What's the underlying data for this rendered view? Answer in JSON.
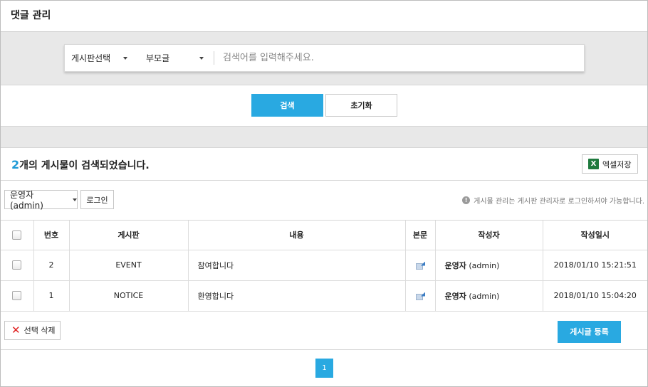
{
  "page": {
    "title": "댓글 관리"
  },
  "search": {
    "board_select": "게시판선택",
    "category_select": "부모글",
    "placeholder": "검색어를 입력해주세요.",
    "search_button": "검색",
    "reset_button": "초기화"
  },
  "results": {
    "count": "2",
    "text": "개의 게시물이 검색되었습니다.",
    "excel_button": "엑셀저장"
  },
  "admin": {
    "selected": "운영자 (admin)",
    "login_button": "로그인",
    "notice": "게시물 관리는 게시판 관리자로 로그인하셔야 가능합니다."
  },
  "table": {
    "headers": [
      "번호",
      "게시판",
      "내용",
      "본문",
      "작성자",
      "작성일시"
    ],
    "rows": [
      {
        "num": "2",
        "board": "EVENT",
        "content": "참여합니다",
        "writer_name": "운영자",
        "writer_id": " (admin)",
        "date": "2018/01/10 15:21:51"
      },
      {
        "num": "1",
        "board": "NOTICE",
        "content": "환영합니다",
        "writer_name": "운영자",
        "writer_id": " (admin)",
        "date": "2018/01/10 15:04:20"
      }
    ]
  },
  "actions": {
    "delete_button": "선택 삭제",
    "register_button": "게시글 등록"
  },
  "pagination": {
    "current": "1"
  },
  "colors": {
    "accent": "#29a9e1",
    "count": "#1e9ad6",
    "delete": "#e02020",
    "excel": "#1f7a3e"
  }
}
